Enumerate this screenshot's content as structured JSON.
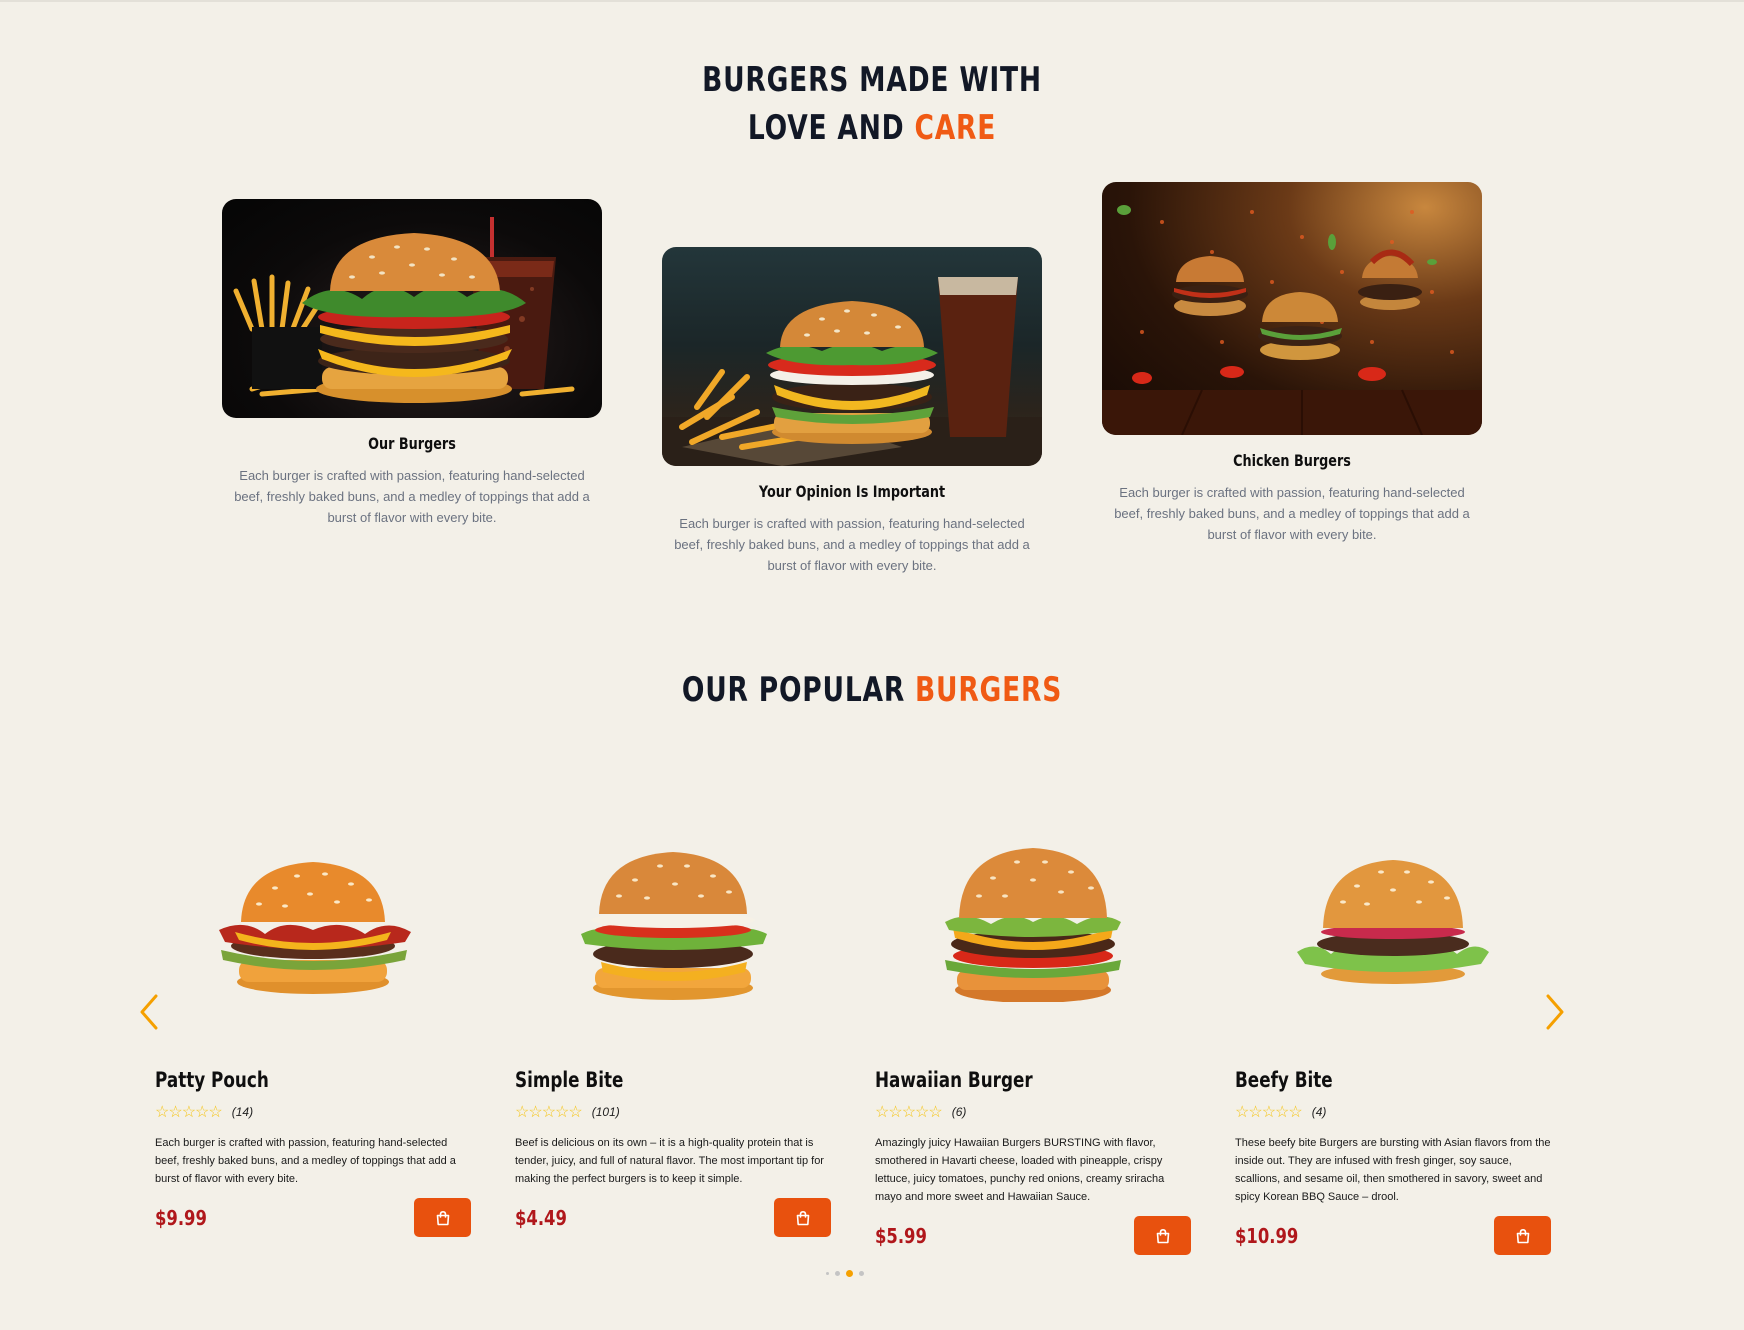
{
  "sections": {
    "love_care": {
      "title_line1": "BURGERS MADE WITH",
      "title_line2_plain": "LOVE AND ",
      "title_line2_accent": "CARE"
    },
    "popular": {
      "title_plain": "OUR POPULAR ",
      "title_accent": "BURGERS"
    }
  },
  "features": [
    {
      "title": "Our Burgers",
      "description": "Each burger is crafted with passion, featuring hand-selected beef, freshly baked buns, and a medley of toppings that add a burst of flavor with every bite."
    },
    {
      "title": "Your Opinion Is Important",
      "description": "Each burger is crafted with passion, featuring hand-selected beef, freshly baked buns, and a medley of toppings that add a burst of flavor with every bite."
    },
    {
      "title": "Chicken Burgers",
      "description": "Each burger is crafted with passion, featuring hand-selected beef, freshly baked buns, and a medley of toppings that add a burst of flavor with every bite."
    }
  ],
  "products": [
    {
      "name": "Patty Pouch",
      "stars": "☆☆☆☆☆",
      "review_count": "(14)",
      "description": "Each burger is crafted with passion, featuring hand-selected beef, freshly baked buns, and a medley of toppings that add a burst of flavor with every bite.",
      "price": "$9.99"
    },
    {
      "name": "Simple Bite",
      "stars": "☆☆☆☆☆",
      "review_count": "(101)",
      "description": "Beef is delicious on its own – it is a high-quality protein that is tender, juicy, and full of natural flavor. The most important tip for making the perfect burgers is to keep it simple.",
      "price": "$4.49"
    },
    {
      "name": "Hawaiian Burger",
      "stars": "☆☆☆☆☆",
      "review_count": "(6)",
      "description": "Amazingly juicy Hawaiian Burgers BURSTING with flavor, smothered in Havarti cheese, loaded with pineapple, crispy lettuce, juicy tomatoes, punchy red onions, creamy sriracha mayo and more sweet and Hawaiian Sauce.",
      "price": "$5.99"
    },
    {
      "name": "Beefy Bite",
      "stars": "☆☆☆☆☆",
      "review_count": "(4)",
      "description": "These beefy bite Burgers are bursting with Asian flavors from the inside out. They are infused with fresh ginger, soy sauce, scallions, and sesame oil, then smothered in savory, sweet and spicy Korean BBQ Sauce – drool.",
      "price": "$10.99"
    }
  ],
  "carousel": {
    "active_dot": 3,
    "dot_count": 4,
    "prev_icon": "chevron-left-icon",
    "next_icon": "chevron-right-icon"
  },
  "colors": {
    "background": "#f3f0e8",
    "accent": "#f05a14",
    "price": "#b0171b",
    "button": "#e8510e",
    "arrow": "#f5a000",
    "star": "#f5c518"
  }
}
